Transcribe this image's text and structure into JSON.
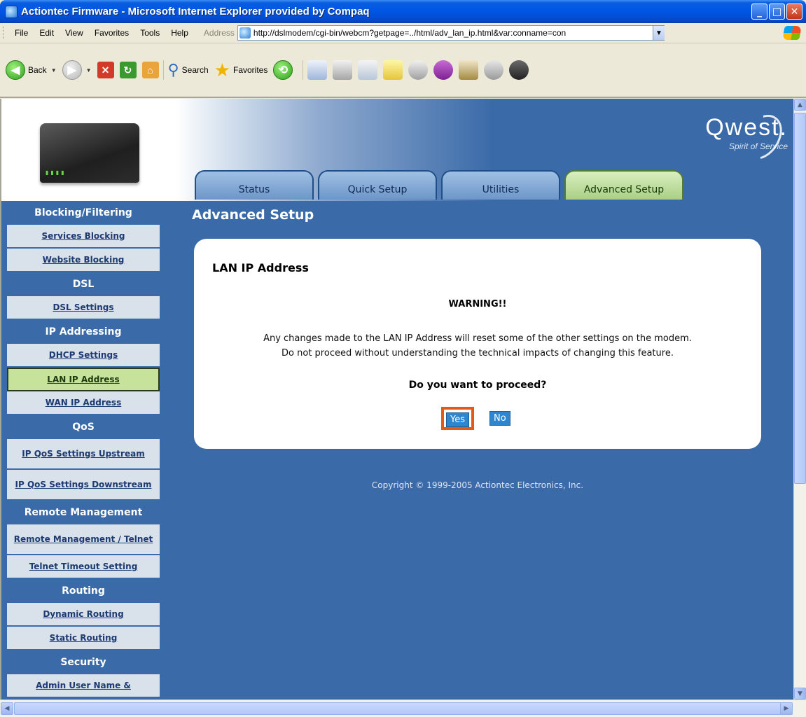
{
  "window": {
    "title": "Actiontec Firmware - Microsoft Internet Explorer provided by Compaq",
    "minimize": "_",
    "maximize": "□",
    "close": "✕"
  },
  "menubar": {
    "items": [
      "File",
      "Edit",
      "View",
      "Favorites",
      "Tools",
      "Help"
    ],
    "address_label": "Address",
    "address_value": "http://dslmodem/cgi-bin/webcm?getpage=../html/adv_lan_ip.html&var:conname=con"
  },
  "toolbar": {
    "back_label": "Back",
    "search_label": "Search",
    "favorites_label": "Favorites"
  },
  "header": {
    "brand": "Qwest.",
    "tagline": "Spirit of Service",
    "tabs": [
      "Status",
      "Quick Setup",
      "Utilities",
      "Advanced Setup"
    ],
    "active_tab": "Advanced Setup"
  },
  "sidebar": {
    "sections": [
      {
        "heading": "Blocking/Filtering",
        "links": [
          "Services Blocking",
          "Website Blocking"
        ]
      },
      {
        "heading": "DSL",
        "links": [
          "DSL Settings"
        ]
      },
      {
        "heading": "IP Addressing",
        "links": [
          "DHCP Settings",
          "LAN IP Address",
          "WAN IP Address"
        ]
      },
      {
        "heading": "QoS",
        "links": [
          "IP QoS Settings Upstream",
          "IP QoS Settings Downstream"
        ]
      },
      {
        "heading": "Remote Management",
        "links": [
          "Remote Management / Telnet",
          "Telnet Timeout Setting"
        ]
      },
      {
        "heading": "Routing",
        "links": [
          "Dynamic Routing",
          "Static Routing"
        ]
      },
      {
        "heading": "Security",
        "links": [
          "Admin User Name &"
        ]
      }
    ],
    "active_link": "LAN IP Address"
  },
  "main": {
    "page_title": "Advanced Setup",
    "card_title": "LAN IP Address",
    "warning": "WARNING!!",
    "warning_line1": "Any changes made to the LAN IP Address will reset some of the other settings on the modem.",
    "warning_line2": "Do not proceed without understanding the technical impacts of changing this feature.",
    "question": "Do you want to proceed?",
    "yes_label": "Yes",
    "no_label": "No",
    "copyright": "Copyright © 1999-2005 Actiontec Electronics, Inc."
  },
  "colors": {
    "page_bg": "#3a6aa8",
    "active_tab": "#a9cf84",
    "button": "#2e86cf",
    "highlight_frame": "#e25a17"
  }
}
